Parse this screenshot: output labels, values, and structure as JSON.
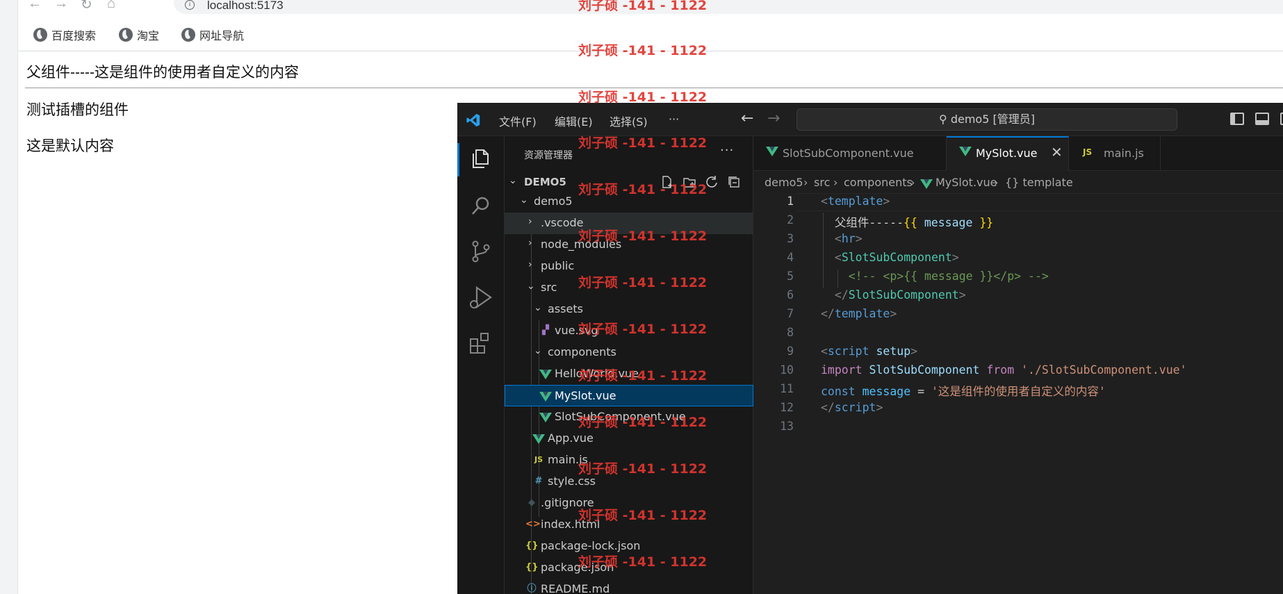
{
  "browser": {
    "url": "localhost:5173",
    "bookmarks": [
      {
        "label": "百度搜索",
        "icon": "globe-icon"
      },
      {
        "label": "淘宝",
        "icon": "globe-icon"
      },
      {
        "label": "网址导航",
        "icon": "globe-icon"
      }
    ]
  },
  "page": {
    "parent_line": "父组件-----这是组件的使用者自定义的内容",
    "slot_title": "测试插槽的组件",
    "default_content": "这是默认内容"
  },
  "vscode": {
    "menus": [
      "文件(F)",
      "编辑(E)",
      "选择(S)",
      "···"
    ],
    "command_center": "demo5 [管理员]",
    "explorer": {
      "title": "资源管理器",
      "more": "···",
      "project": "DEMO5",
      "tree": [
        {
          "label": "demo5",
          "type": "folder",
          "open": true
        },
        {
          "label": ".vscode",
          "type": "folder",
          "open": false
        },
        {
          "label": "node_modules",
          "type": "folder",
          "open": false
        },
        {
          "label": "public",
          "type": "folder",
          "open": false
        },
        {
          "label": "src",
          "type": "folder",
          "open": true
        },
        {
          "label": "assets",
          "type": "folder",
          "open": true
        },
        {
          "label": "vue.svg",
          "type": "svg"
        },
        {
          "label": "components",
          "type": "folder",
          "open": true
        },
        {
          "label": "HelloWorld.vue",
          "type": "vue"
        },
        {
          "label": "MySlot.vue",
          "type": "vue",
          "selected": true
        },
        {
          "label": "SlotSubComponent.vue",
          "type": "vue"
        },
        {
          "label": "App.vue",
          "type": "vue"
        },
        {
          "label": "main.js",
          "type": "js"
        },
        {
          "label": "style.css",
          "type": "css"
        },
        {
          "label": ".gitignore",
          "type": "git"
        },
        {
          "label": "index.html",
          "type": "html"
        },
        {
          "label": "package-lock.json",
          "type": "json"
        },
        {
          "label": "package.json",
          "type": "json"
        },
        {
          "label": "README.md",
          "type": "md"
        }
      ]
    },
    "tabs": [
      {
        "label": "SlotSubComponent.vue",
        "icon": "vue-icon"
      },
      {
        "label": "MySlot.vue",
        "icon": "vue-icon",
        "active": true
      },
      {
        "label": "main.js",
        "icon": "js-icon"
      }
    ],
    "breadcrumb": [
      "demo5",
      "src",
      "components",
      "MySlot.vue",
      "{} template"
    ],
    "line_numbers": [
      "1",
      "2",
      "3",
      "4",
      "5",
      "6",
      "7",
      "8",
      "9",
      "10",
      "11",
      "12",
      "13"
    ],
    "code": {
      "l1_open": "<",
      "l1_tag": "template",
      "l1_close": ">",
      "l2_text": "父组件-----",
      "l2_open": "{{",
      "l2_var": "message",
      "l2_close": "}}",
      "l3_open": "<",
      "l3_tag": "hr",
      "l3_close": ">",
      "l4_open": "<",
      "l4_tag": "SlotSubComponent",
      "l4_close": ">",
      "l5_comment": "<!-- <p>{{ message }}</p> -->",
      "l6_open": "</",
      "l6_tag": "SlotSubComponent",
      "l6_close": ">",
      "l7_open": "</",
      "l7_tag": "template",
      "l7_close": ">",
      "l9_open": "<",
      "l9_tag": "script",
      "l9_attr": "setup",
      "l9_close": ">",
      "l10_kw": "import",
      "l10_name": "SlotSubComponent",
      "l10_from": "from",
      "l10_str": "'./SlotSubComponent.vue'",
      "l11_kw": "const",
      "l11_name": "message",
      "l11_eq": "=",
      "l11_str": "'这是组件的使用者自定义的内容'",
      "l12_open": "</",
      "l12_tag": "script",
      "l12_close": ">"
    }
  },
  "watermark": "刘子硕 -141 - 1122",
  "colors": {
    "accent": "#0078d4",
    "watermark": "#e0362f",
    "vue_green": "#41b883"
  }
}
